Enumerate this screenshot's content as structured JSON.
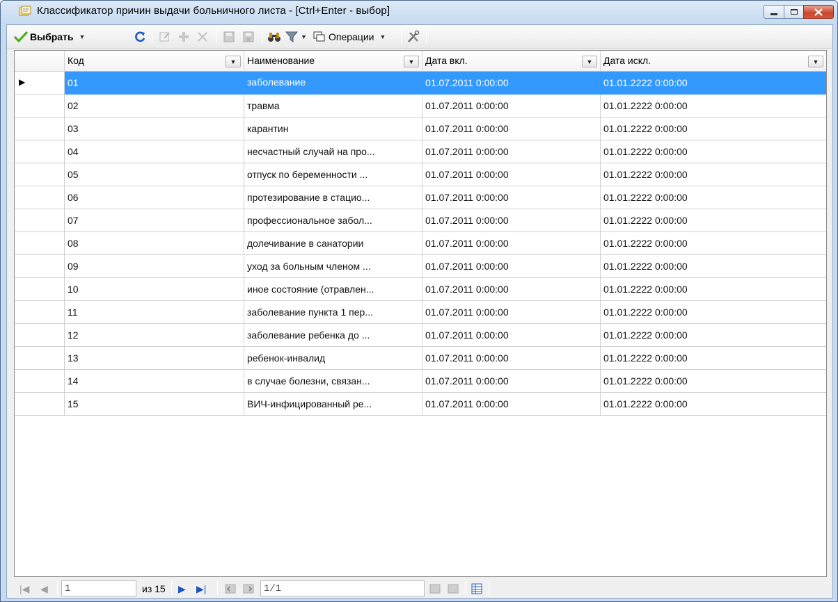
{
  "window": {
    "title": "Классификатор причин выдачи больничного листа - [Ctrl+Enter - выбор]"
  },
  "toolbar": {
    "select_label": "Выбрать",
    "operations_label": "Операции"
  },
  "grid": {
    "columns": [
      "Код",
      "Наименование",
      "Дата вкл.",
      "Дата искл."
    ],
    "selected_row_index": 0,
    "rows": [
      [
        "01",
        "заболевание",
        "01.07.2011 0:00:00",
        "01.01.2222 0:00:00"
      ],
      [
        "02",
        "травма",
        "01.07.2011 0:00:00",
        "01.01.2222 0:00:00"
      ],
      [
        "03",
        "карантин",
        "01.07.2011 0:00:00",
        "01.01.2222 0:00:00"
      ],
      [
        "04",
        "несчастный случай на про...",
        "01.07.2011 0:00:00",
        "01.01.2222 0:00:00"
      ],
      [
        "05",
        "отпуск по беременности ...",
        "01.07.2011 0:00:00",
        "01.01.2222 0:00:00"
      ],
      [
        "06",
        "протезирование в стацио...",
        "01.07.2011 0:00:00",
        "01.01.2222 0:00:00"
      ],
      [
        "07",
        "профессиональное забол...",
        "01.07.2011 0:00:00",
        "01.01.2222 0:00:00"
      ],
      [
        "08",
        "долечивание в санатории",
        "01.07.2011 0:00:00",
        "01.01.2222 0:00:00"
      ],
      [
        "09",
        "уход за больным членом ...",
        "01.07.2011 0:00:00",
        "01.01.2222 0:00:00"
      ],
      [
        "10",
        "иное состояние (отравлен...",
        "01.07.2011 0:00:00",
        "01.01.2222 0:00:00"
      ],
      [
        "11",
        "заболевание пункта 1 пер...",
        "01.07.2011 0:00:00",
        "01.01.2222 0:00:00"
      ],
      [
        "12",
        "заболевание ребенка до ...",
        "01.07.2011 0:00:00",
        "01.01.2222 0:00:00"
      ],
      [
        "13",
        "ребенок-инвалид",
        "01.07.2011 0:00:00",
        "01.01.2222 0:00:00"
      ],
      [
        "14",
        "в случае болезни, связан...",
        "01.07.2011 0:00:00",
        "01.01.2222 0:00:00"
      ],
      [
        "15",
        "ВИЧ-инфицированный ре...",
        "01.07.2011 0:00:00",
        "01.01.2222 0:00:00"
      ]
    ]
  },
  "pager": {
    "current_record": "1",
    "total_label": "из 15",
    "page_value": "1/1"
  },
  "colors": {
    "selection": "#3399ff",
    "accent_green": "#4caf1a"
  }
}
